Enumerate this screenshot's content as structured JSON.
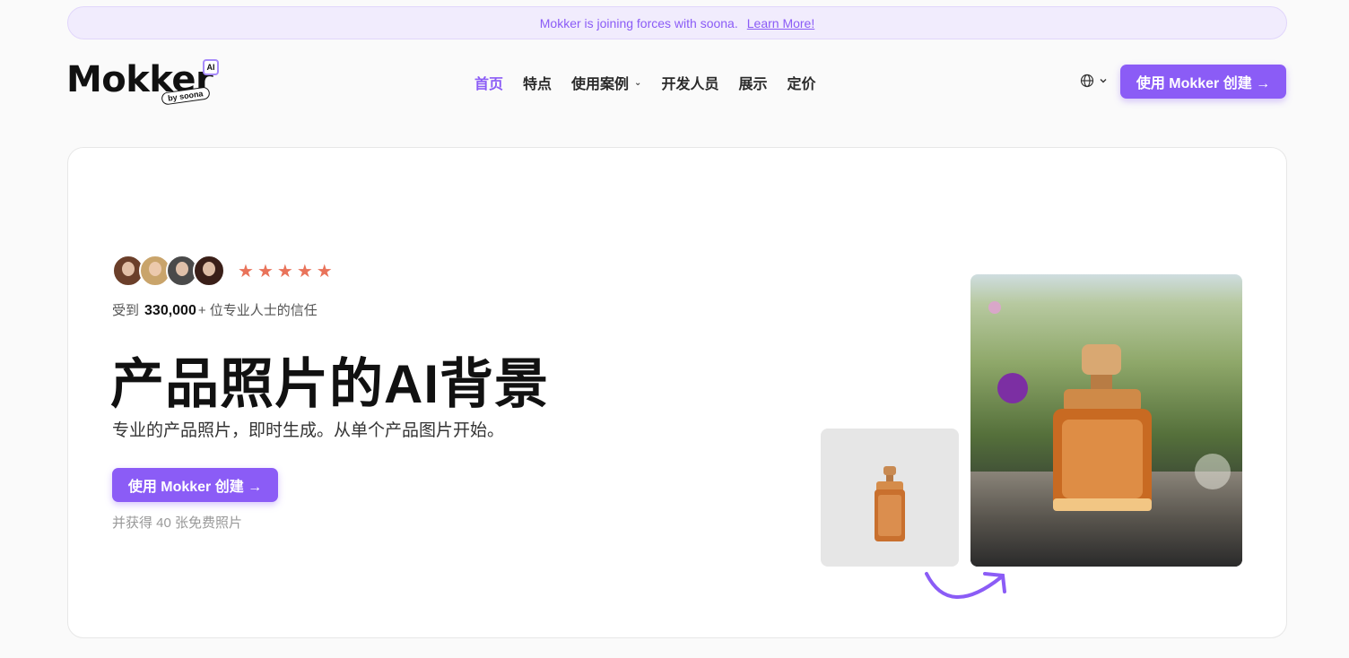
{
  "banner": {
    "text": "Mokker is joining forces with soona.",
    "link": "Learn More!"
  },
  "logo": {
    "name": "Mokker",
    "badge": "AI",
    "byline": "by soona"
  },
  "nav": {
    "items": [
      {
        "label": "首页",
        "active": true
      },
      {
        "label": "特点"
      },
      {
        "label": "使用案例",
        "dropdown": true
      },
      {
        "label": "开发人员"
      },
      {
        "label": "展示"
      },
      {
        "label": "定价"
      }
    ]
  },
  "header": {
    "language_icon": "globe-icon",
    "cta_label": "使用 Mokker 创建 →"
  },
  "hero": {
    "rating_stars": 5,
    "trust_prefix": "受到",
    "trust_count": "330,000",
    "trust_plus": "+",
    "trust_suffix": " 位专业人士的信任",
    "title": "产品照片的AI背景",
    "subtitle": "专业的产品照片，即时生成。从单个产品图片开始。",
    "cta_label": "使用 Mokker 创建 →",
    "note": "并获得 40 张免费照片"
  },
  "colors": {
    "accent": "#8b5cf6",
    "star": "#e9735a",
    "banner_bg": "#f1ecfd"
  }
}
